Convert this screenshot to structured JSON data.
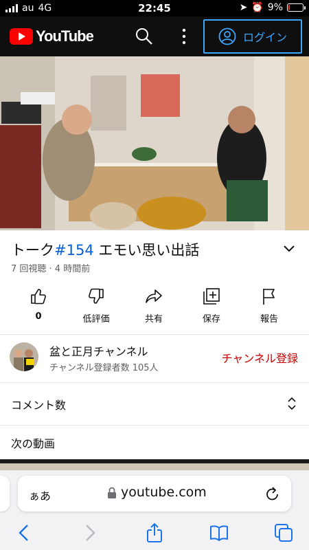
{
  "status_bar": {
    "carrier": "au",
    "network": "4G",
    "time": "22:45",
    "battery": "9%",
    "battery_level": 0.09
  },
  "header": {
    "logo_text": "YouTube",
    "login_label": "ログイン",
    "accent": "#3ea6ff",
    "brand_red": "#ff0000"
  },
  "video": {
    "title_prefix": "トーク",
    "title_tag": "#154",
    "title_suffix": " エモい思い出話",
    "meta": "7 回視聴 · 4 時間前"
  },
  "actions": [
    {
      "icon": "thumbs-up-icon",
      "label": "0"
    },
    {
      "icon": "thumbs-down-icon",
      "label": "低評価"
    },
    {
      "icon": "share-icon",
      "label": "共有"
    },
    {
      "icon": "save-icon",
      "label": "保存"
    },
    {
      "icon": "flag-icon",
      "label": "報告"
    }
  ],
  "channel": {
    "name": "盆と正月チャンネル",
    "subscribers": "チャンネル登録者数 105人",
    "subscribe_label": "チャンネル登録",
    "subscribe_color": "#cc0000"
  },
  "comments": {
    "label": "コメント数"
  },
  "next": {
    "label": "次の動画"
  },
  "safari": {
    "text_size_label": "ぁあ",
    "url": "youtube.com"
  }
}
